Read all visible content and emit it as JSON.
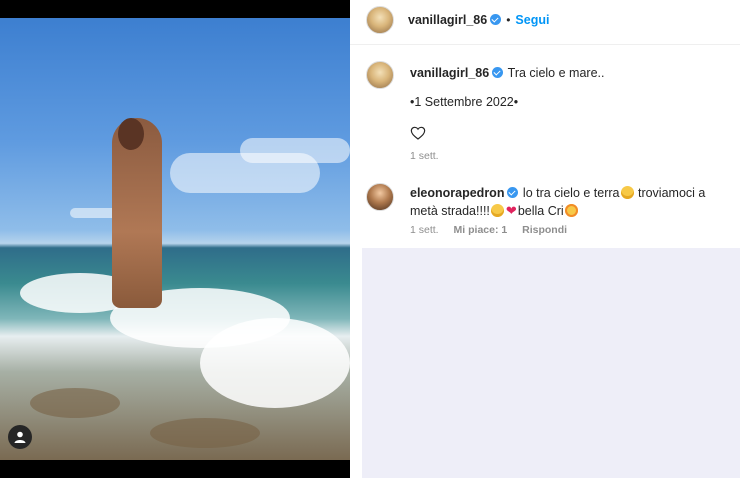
{
  "post": {
    "author": "vanillagirl_86",
    "follow_label": "Segui",
    "dot": "•"
  },
  "caption": {
    "author": "vanillagirl_86",
    "text": "Tra cielo e mare..",
    "date_line": "•1 Settembre 2022•",
    "time": "1 sett."
  },
  "comment": {
    "author": "eleonorapedron",
    "text_1": "lo tra cielo e terra",
    "text_2": " troviamoci a metà strada!!!!",
    "text_3": "bella Cri",
    "time": "1 sett.",
    "likes": "Mi piace: 1",
    "reply_label": "Rispondi"
  },
  "icons": {
    "verified": "verified-badge-icon",
    "heart": "heart-outline-icon",
    "user_tag": "user-tag-icon"
  },
  "colors": {
    "accent": "#0095f6",
    "verified": "#3897f0",
    "muted": "#8e8e8e"
  }
}
